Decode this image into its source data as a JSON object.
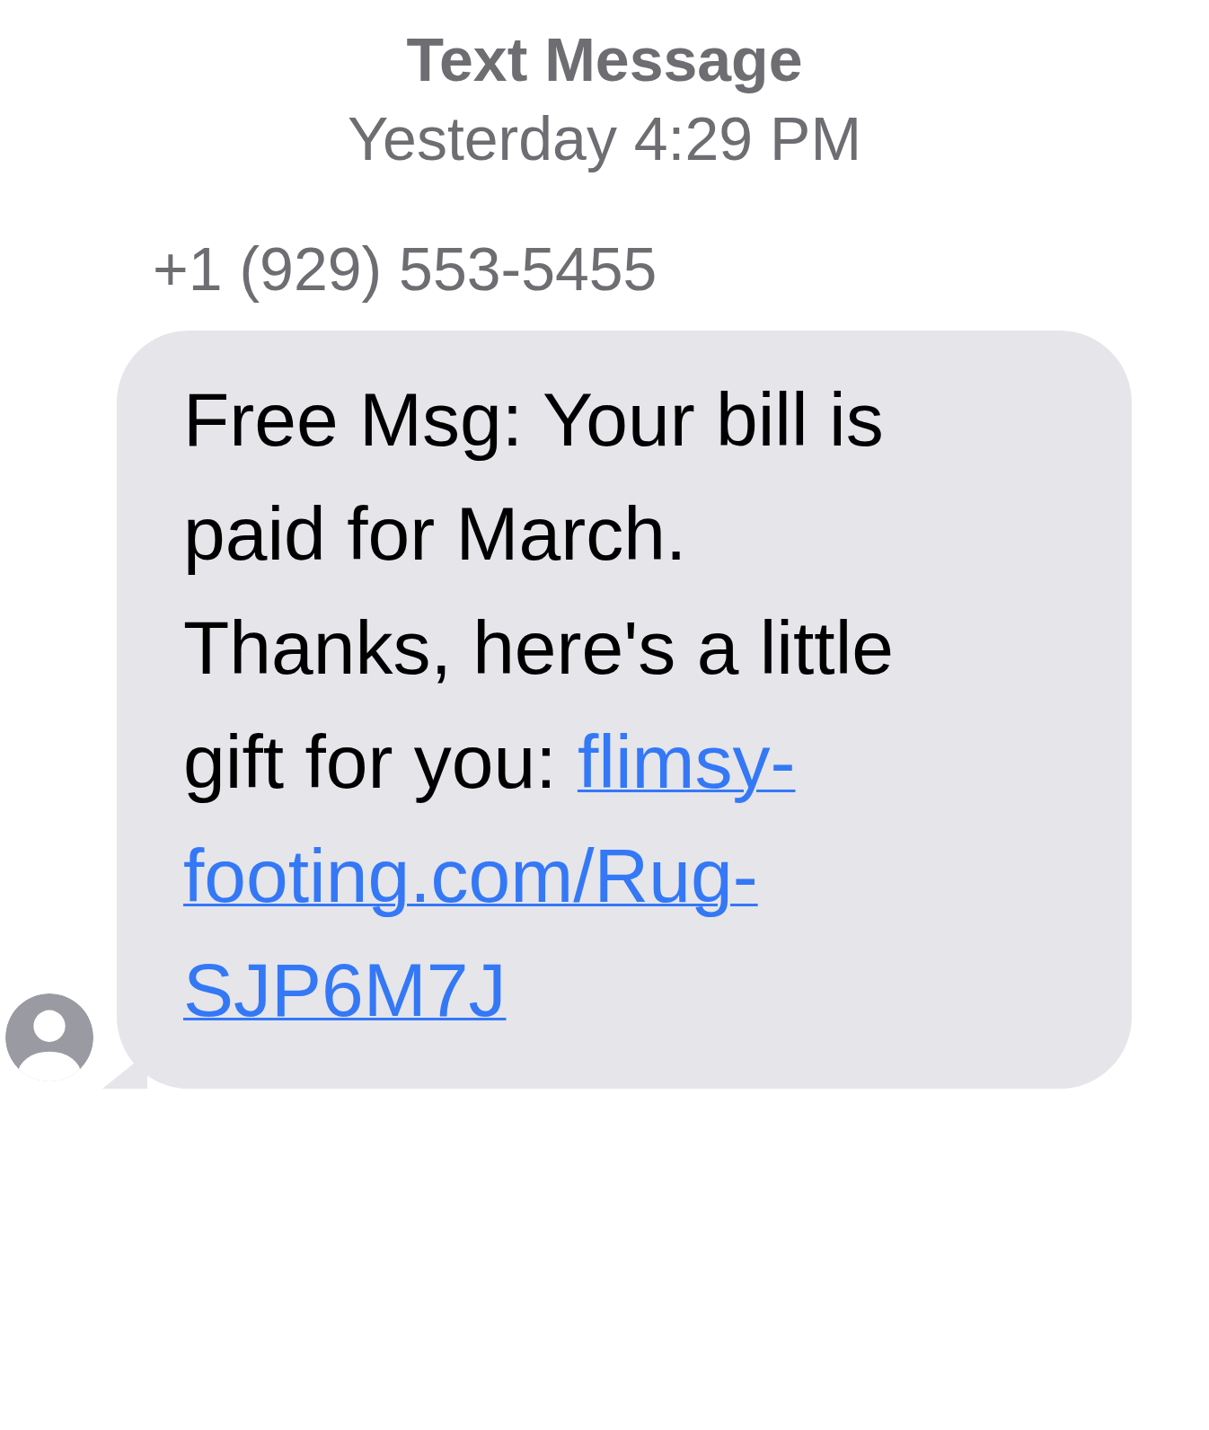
{
  "header": {
    "title": "Text Message",
    "timestamp": "Yesterday 4:29 PM"
  },
  "messages": [
    {
      "sender": "+1 (929) 553-5455",
      "kind": "incoming",
      "text_lines": [
        "Free Msg: Your bill is",
        "paid for March.",
        "Thanks, here's a little",
        "gift for you:"
      ],
      "link_lines": [
        "flimsy-",
        "footing.com/Rug-",
        "SJP6M7J"
      ]
    }
  ]
}
